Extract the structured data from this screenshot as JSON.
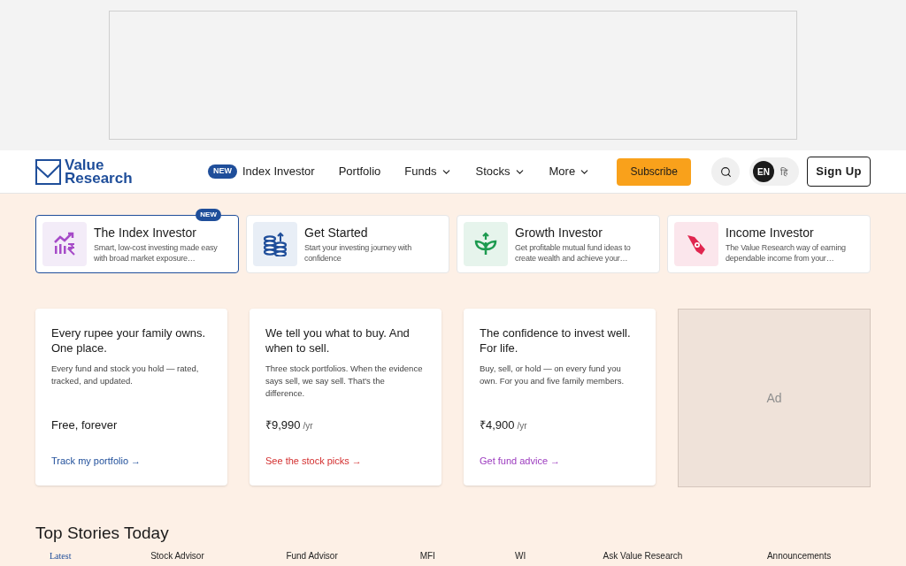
{
  "nav": {
    "logo": [
      "Value",
      "Research"
    ],
    "items": [
      {
        "label": "Index Investor",
        "badge": "NEW",
        "dropdown": false
      },
      {
        "label": "Portfolio",
        "dropdown": false
      },
      {
        "label": "Funds",
        "dropdown": true
      },
      {
        "label": "Stocks",
        "dropdown": true
      },
      {
        "label": "More",
        "dropdown": true
      }
    ],
    "subscribe": "Subscribe",
    "languages": [
      {
        "label": "EN",
        "selected": true
      },
      {
        "label": "हि",
        "selected": false
      }
    ],
    "signup": "Sign Up"
  },
  "products": [
    {
      "title": "The Index Investor",
      "description": "Smart, low-cost investing made easy with broad market exposure…",
      "badge": "NEW",
      "selected": true,
      "kind": "index"
    },
    {
      "title": "Get Started",
      "description": "Start your investing journey with confidence",
      "selected": false,
      "kind": "coins"
    },
    {
      "title": "Growth Investor",
      "description": "Get profitable mutual fund ideas to create wealth and achieve your…",
      "selected": false,
      "kind": "growth"
    },
    {
      "title": "Income Investor",
      "description": "The Value Research way of earning dependable income from your…",
      "selected": false,
      "kind": "income"
    }
  ],
  "plans": [
    {
      "headline": "Every rupee your family owns. One place.",
      "description": "Every fund and stock you hold — rated, tracked, and updated.",
      "price": "Free, forever",
      "link": "Track my portfolio →",
      "color": "#1f4e9a"
    },
    {
      "headline": "We tell you what to buy. And when to sell.",
      "description": "Three stock portfolios. When the evidence says sell, we say sell. That's the difference.",
      "price": "₹9,990",
      "period": "/yr",
      "link": "See the stock picks →",
      "color": "#d32f2f"
    },
    {
      "headline": "The confidence to invest well. For life.",
      "description": "Buy, sell, or hold — on every fund you own. For you and five family members.",
      "price": "₹4,900",
      "period": "/yr",
      "link": "Get fund advice →",
      "color": "#9c3bbf"
    }
  ],
  "ad": {
    "label": "Ad"
  },
  "stories": {
    "title": "Top Stories Today",
    "tabs": [
      {
        "label": "Latest",
        "selected": true
      },
      {
        "label": "Stock Advisor",
        "selected": false
      },
      {
        "label": "Fund Advisor",
        "selected": false
      },
      {
        "label": "MFI",
        "selected": false
      },
      {
        "label": "WI",
        "selected": false
      },
      {
        "label": "Ask Value Research",
        "selected": false
      },
      {
        "label": "Announcements",
        "selected": false
      }
    ]
  }
}
